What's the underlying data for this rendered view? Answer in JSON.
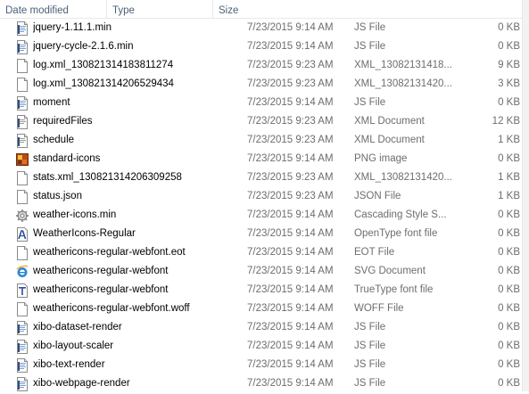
{
  "columns": {
    "date_modified": "Date modified",
    "type": "Type",
    "size": "Size"
  },
  "files": [
    {
      "name": "jquery-1.11.1.min",
      "date": "7/23/2015 9:14 AM",
      "type": "JS File",
      "size": "0 KB",
      "icon": "js-file-icon"
    },
    {
      "name": "jquery-cycle-2.1.6.min",
      "date": "7/23/2015 9:14 AM",
      "type": "JS File",
      "size": "0 KB",
      "icon": "js-file-icon"
    },
    {
      "name": "log.xml_130821314183811274",
      "date": "7/23/2015 9:23 AM",
      "type": "XML_13082131418...",
      "size": "9 KB",
      "icon": "blank-file-icon"
    },
    {
      "name": "log.xml_130821314206529434",
      "date": "7/23/2015 9:23 AM",
      "type": "XML_13082131420...",
      "size": "3 KB",
      "icon": "blank-file-icon"
    },
    {
      "name": "moment",
      "date": "7/23/2015 9:14 AM",
      "type": "JS File",
      "size": "0 KB",
      "icon": "js-file-icon"
    },
    {
      "name": "requiredFiles",
      "date": "7/23/2015 9:23 AM",
      "type": "XML Document",
      "size": "12 KB",
      "icon": "xml-document-icon"
    },
    {
      "name": "schedule",
      "date": "7/23/2015 9:23 AM",
      "type": "XML Document",
      "size": "1 KB",
      "icon": "xml-document-icon"
    },
    {
      "name": "standard-icons",
      "date": "7/23/2015 9:14 AM",
      "type": "PNG image",
      "size": "0 KB",
      "icon": "png-image-icon"
    },
    {
      "name": "stats.xml_130821314206309258",
      "date": "7/23/2015 9:23 AM",
      "type": "XML_13082131420...",
      "size": "1 KB",
      "icon": "blank-file-icon"
    },
    {
      "name": "status.json",
      "date": "7/23/2015 9:23 AM",
      "type": "JSON File",
      "size": "1 KB",
      "icon": "blank-file-icon"
    },
    {
      "name": "weather-icons.min",
      "date": "7/23/2015 9:14 AM",
      "type": "Cascading Style S...",
      "size": "0 KB",
      "icon": "css-file-icon"
    },
    {
      "name": "WeatherIcons-Regular",
      "date": "7/23/2015 9:14 AM",
      "type": "OpenType font file",
      "size": "0 KB",
      "icon": "opentype-font-icon"
    },
    {
      "name": "weathericons-regular-webfont.eot",
      "date": "7/23/2015 9:14 AM",
      "type": "EOT File",
      "size": "0 KB",
      "icon": "blank-file-icon"
    },
    {
      "name": "weathericons-regular-webfont",
      "date": "7/23/2015 9:14 AM",
      "type": "SVG Document",
      "size": "0 KB",
      "icon": "ie-svg-document-icon"
    },
    {
      "name": "weathericons-regular-webfont",
      "date": "7/23/2015 9:14 AM",
      "type": "TrueType font file",
      "size": "0 KB",
      "icon": "truetype-font-icon"
    },
    {
      "name": "weathericons-regular-webfont.woff",
      "date": "7/23/2015 9:14 AM",
      "type": "WOFF File",
      "size": "0 KB",
      "icon": "blank-file-icon"
    },
    {
      "name": "xibo-dataset-render",
      "date": "7/23/2015 9:14 AM",
      "type": "JS File",
      "size": "0 KB",
      "icon": "js-file-icon"
    },
    {
      "name": "xibo-layout-scaler",
      "date": "7/23/2015 9:14 AM",
      "type": "JS File",
      "size": "0 KB",
      "icon": "js-file-icon"
    },
    {
      "name": "xibo-text-render",
      "date": "7/23/2015 9:14 AM",
      "type": "JS File",
      "size": "0 KB",
      "icon": "js-file-icon"
    },
    {
      "name": "xibo-webpage-render",
      "date": "7/23/2015 9:14 AM",
      "type": "JS File",
      "size": "0 KB",
      "icon": "js-file-icon"
    }
  ]
}
